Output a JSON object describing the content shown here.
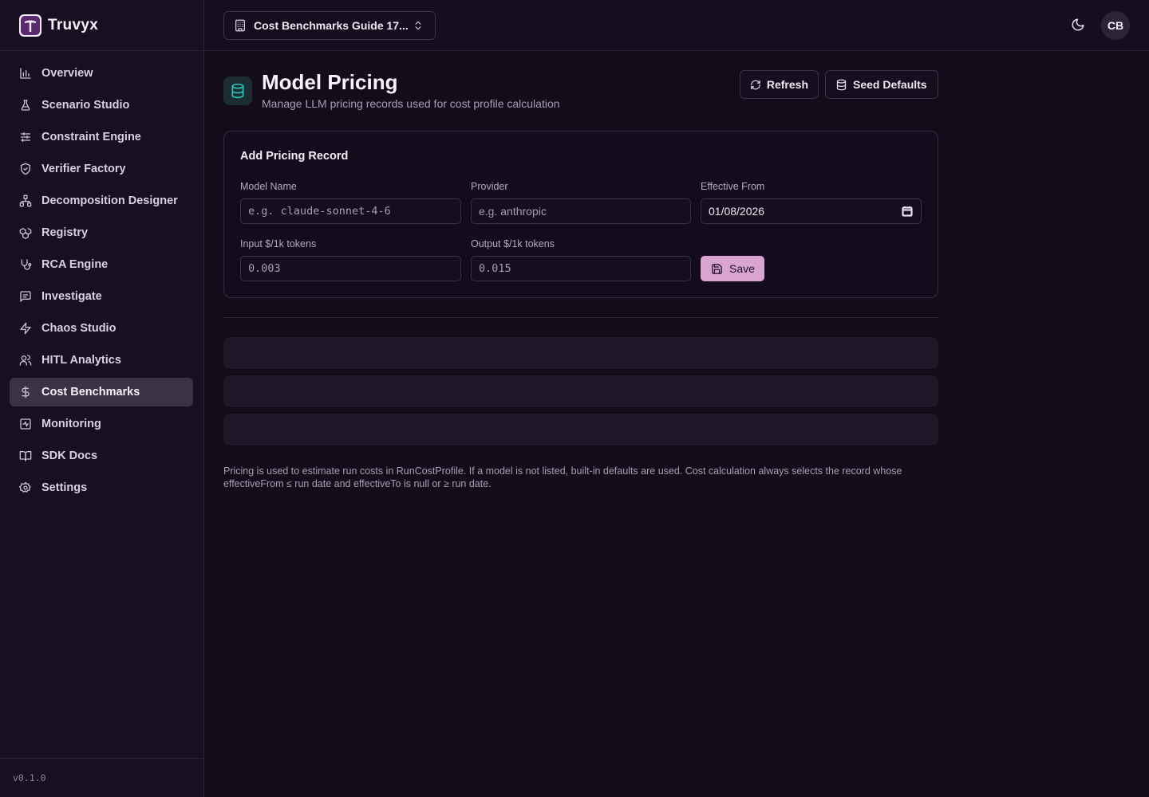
{
  "brand": {
    "name": "Truvyx"
  },
  "sidebar": {
    "items": [
      {
        "label": "Overview",
        "icon": "bar-chart-icon"
      },
      {
        "label": "Scenario Studio",
        "icon": "flask-icon"
      },
      {
        "label": "Constraint Engine",
        "icon": "sliders-icon"
      },
      {
        "label": "Verifier Factory",
        "icon": "shield-check-icon"
      },
      {
        "label": "Decomposition Designer",
        "icon": "network-icon"
      },
      {
        "label": "Registry",
        "icon": "boxes-icon"
      },
      {
        "label": "RCA Engine",
        "icon": "stethoscope-icon"
      },
      {
        "label": "Investigate",
        "icon": "message-square-icon"
      },
      {
        "label": "Chaos Studio",
        "icon": "zap-icon"
      },
      {
        "label": "HITL Analytics",
        "icon": "users-icon"
      },
      {
        "label": "Cost Benchmarks",
        "icon": "dollar-icon",
        "active": true
      },
      {
        "label": "Monitoring",
        "icon": "activity-square-icon"
      },
      {
        "label": "SDK Docs",
        "icon": "book-open-icon"
      },
      {
        "label": "Settings",
        "icon": "gear-icon"
      }
    ],
    "version": "v0.1.0"
  },
  "header": {
    "project_label": "Cost Benchmarks Guide 17...",
    "avatar_initials": "CB"
  },
  "page": {
    "title": "Model Pricing",
    "subtitle": "Manage LLM pricing records used for cost profile calculation",
    "refresh_label": "Refresh",
    "seed_label": "Seed Defaults"
  },
  "form": {
    "title": "Add Pricing Record",
    "model_name_label": "Model Name",
    "model_name_placeholder": "e.g. claude-sonnet-4-6",
    "provider_label": "Provider",
    "provider_placeholder": "e.g. anthropic",
    "effective_from_label": "Effective From",
    "effective_from_value": "01/08/2026",
    "input_label": "Input $/1k tokens",
    "input_placeholder": "0.003",
    "output_label": "Output $/1k tokens",
    "output_placeholder": "0.015",
    "save_label": "Save"
  },
  "footnote": "Pricing is used to estimate run costs in RunCostProfile. If a model is not listed, built-in defaults are used. Cost calculation always selects the record whose effectiveFrom ≤ run date and effectiveTo is null or ≥ run date.",
  "colors": {
    "background": "#120c1b",
    "sidebar": "#170f22",
    "active_nav": "#3a3245",
    "accent_save": "#d9a4d1",
    "page_icon": "#2bc1b6"
  }
}
